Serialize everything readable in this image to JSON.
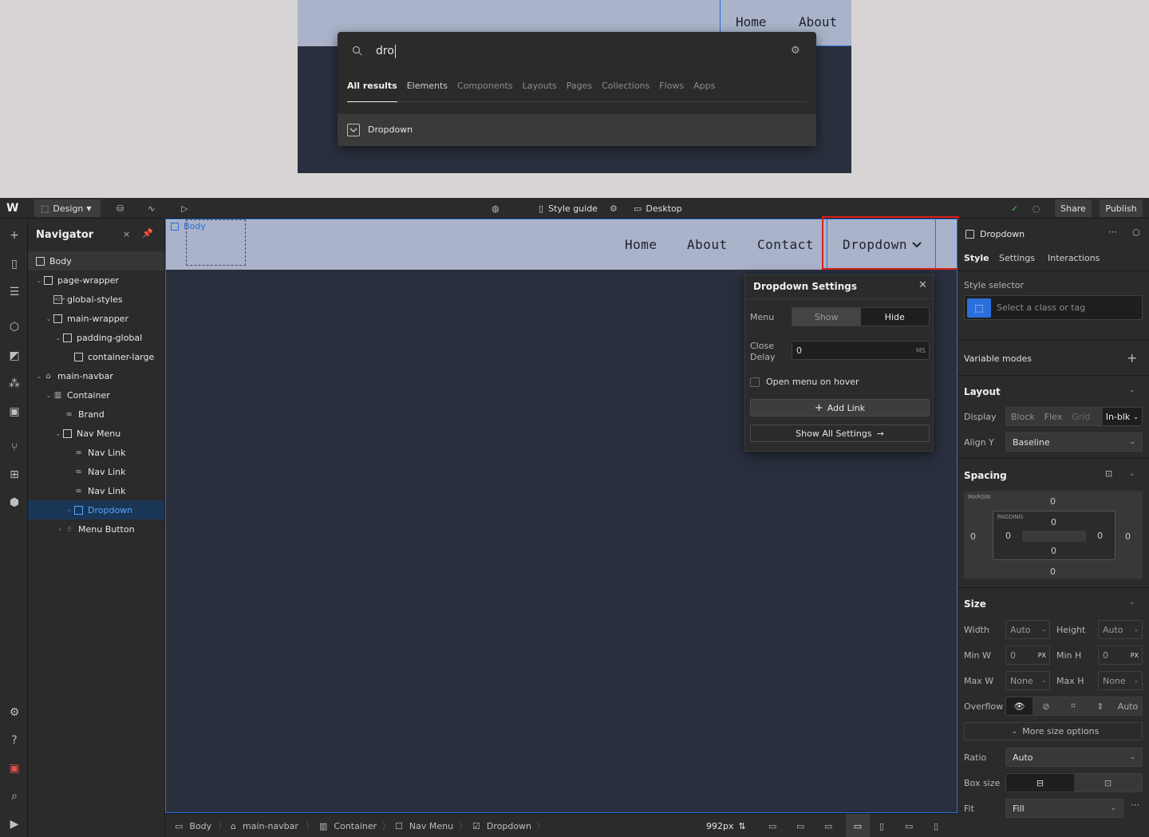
{
  "preview": {
    "nav_links": [
      "Home",
      "About"
    ],
    "search": {
      "value": "dro",
      "tabs": [
        "All results",
        "Elements",
        "Components",
        "Layouts",
        "Pages",
        "Collections",
        "Flows",
        "Apps"
      ],
      "result_label": "Dropdown"
    }
  },
  "topbar": {
    "mode_label": "Design",
    "style_guide_label": "Style guide",
    "breakpoint_label": "Desktop",
    "share_label": "Share",
    "publish_label": "Publish"
  },
  "navigator": {
    "title": "Navigator",
    "items": [
      {
        "label": "Body",
        "icon": "square-icon"
      },
      {
        "label": "page-wrapper",
        "icon": "square-icon"
      },
      {
        "label": "global-styles",
        "icon": "code-embed-icon"
      },
      {
        "label": "main-wrapper",
        "icon": "square-icon"
      },
      {
        "label": "padding-global",
        "icon": "square-icon"
      },
      {
        "label": "container-large",
        "icon": "square-icon"
      },
      {
        "label": "main-navbar",
        "icon": "navbar-icon"
      },
      {
        "label": "Container",
        "icon": "container-icon"
      },
      {
        "label": "Brand",
        "icon": "link-icon"
      },
      {
        "label": "Nav Menu",
        "icon": "square-icon"
      },
      {
        "label": "Nav Link",
        "icon": "link-icon"
      },
      {
        "label": "Nav Link",
        "icon": "link-icon"
      },
      {
        "label": "Nav Link",
        "icon": "link-icon"
      },
      {
        "label": "Dropdown",
        "icon": "dropdown-icon"
      },
      {
        "label": "Menu Button",
        "icon": "hand-icon"
      }
    ]
  },
  "canvas": {
    "body_tag": "Body",
    "nav_links": [
      "Home",
      "About",
      "Contact"
    ],
    "dropdown_label": "Dropdown",
    "dropdown_settings": {
      "title": "Dropdown Settings",
      "menu_label": "Menu",
      "show_label": "Show",
      "hide_label": "Hide",
      "close_delay_label": "Close Delay",
      "close_delay_value": "0",
      "close_delay_unit": "MS",
      "hover_label": "Open menu on hover",
      "add_link_label": "Add Link",
      "show_all_label": "Show All Settings"
    }
  },
  "right_panel": {
    "element_name": "Dropdown",
    "tabs": [
      "Style",
      "Settings",
      "Interactions"
    ],
    "style_selector_label": "Style selector",
    "selector_placeholder": "Select a class or tag",
    "variable_modes_label": "Variable modes",
    "layout": {
      "title": "Layout",
      "display_label": "Display",
      "display_options": [
        "Block",
        "Flex",
        "Grid",
        "In-blk"
      ],
      "align_y_label": "Align Y",
      "align_y_value": "Baseline"
    },
    "spacing": {
      "title": "Spacing",
      "margin_label": "MARGIN",
      "padding_label": "PADDING",
      "margin": {
        "top": "0",
        "right": "0",
        "bottom": "0",
        "left": "0"
      },
      "padding": {
        "top": "0",
        "right": "0",
        "bottom": "0",
        "left": "0"
      }
    },
    "size": {
      "title": "Size",
      "width_label": "Width",
      "width_value": "Auto",
      "height_label": "Height",
      "height_value": "Auto",
      "minw_label": "Min W",
      "minw_value": "0",
      "minw_unit": "PX",
      "minh_label": "Min H",
      "minh_value": "0",
      "minh_unit": "PX",
      "maxw_label": "Max W",
      "maxw_value": "None",
      "maxh_label": "Max H",
      "maxh_value": "None",
      "overflow_label": "Overflow",
      "overflow_auto": "Auto",
      "more_label": "More size options",
      "ratio_label": "Ratio",
      "ratio_value": "Auto",
      "boxsize_label": "Box size",
      "fit_label": "Fit",
      "fit_value": "Fill"
    }
  },
  "bottombar": {
    "breadcrumbs": [
      "Body",
      "main-navbar",
      "Container",
      "Nav Menu",
      "Dropdown"
    ],
    "width_value": "992px"
  },
  "colors": {
    "accent": "#2a6fdb",
    "highlight": "#e0201b",
    "selection": "#1a3657"
  }
}
